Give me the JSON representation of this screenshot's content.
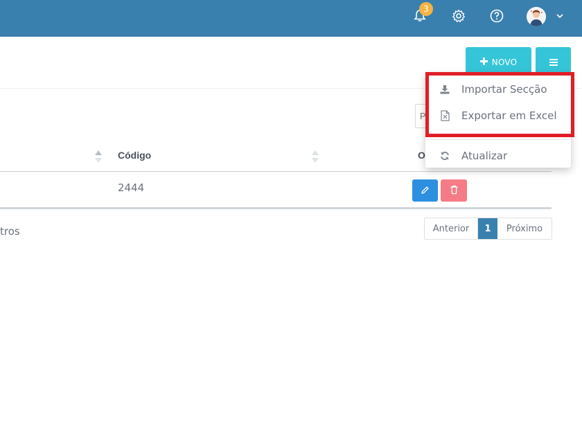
{
  "topbar": {
    "notification_count": "3",
    "icons": [
      "bell-icon",
      "gear-icon",
      "help-icon",
      "avatar",
      "chevron-down-icon"
    ],
    "background": "#3a80ae"
  },
  "toolbar": {
    "new_label": "NOVO",
    "accent": "#35c5d8"
  },
  "search": {
    "placeholder": "P"
  },
  "table": {
    "columns": [
      "",
      "Código",
      "O"
    ],
    "rows": [
      {
        "codigo": "2444"
      }
    ]
  },
  "footer": {
    "info_text": "tros",
    "pagination": {
      "prev": "Anterior",
      "current": "1",
      "next": "Próximo"
    }
  },
  "dropdown": {
    "items": [
      {
        "label": "Importar Secção",
        "icon": "download-icon"
      },
      {
        "label": "Exportar em Excel",
        "icon": "excel-file-icon"
      },
      {
        "label": "Atualizar",
        "icon": "refresh-icon"
      }
    ],
    "highlight_color": "#e01e26"
  }
}
